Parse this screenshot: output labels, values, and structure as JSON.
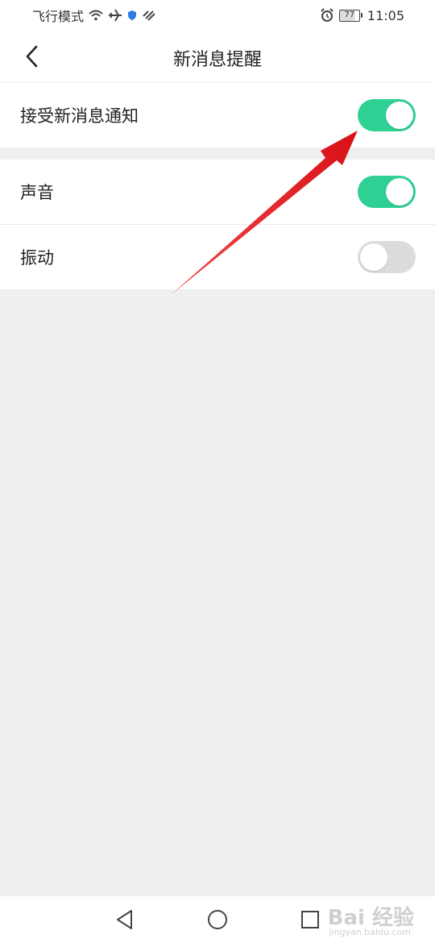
{
  "status_bar": {
    "left_text": "飞行模式",
    "time": "11:05",
    "battery": "77",
    "icons": [
      "wifi-icon",
      "airplane-icon",
      "shield-icon",
      "signal-slash-icon",
      "alarm-icon",
      "battery-icon"
    ]
  },
  "header": {
    "title": "新消息提醒",
    "back_icon": "chevron-left-icon"
  },
  "settings": [
    {
      "label": "接受新消息通知",
      "enabled": true
    },
    {
      "label": "声音",
      "enabled": true
    },
    {
      "label": "振动",
      "enabled": false
    }
  ],
  "colors": {
    "toggle_on": "#2fd093",
    "toggle_off": "#dcdcdc",
    "background": "#efefef",
    "arrow": "#e8141b"
  },
  "watermark": {
    "text": "Bai 经验",
    "sub": "jingyan.baidu.com"
  },
  "nav_bar": {
    "icons": [
      "back-triangle-icon",
      "home-circle-icon",
      "recents-square-icon"
    ]
  }
}
